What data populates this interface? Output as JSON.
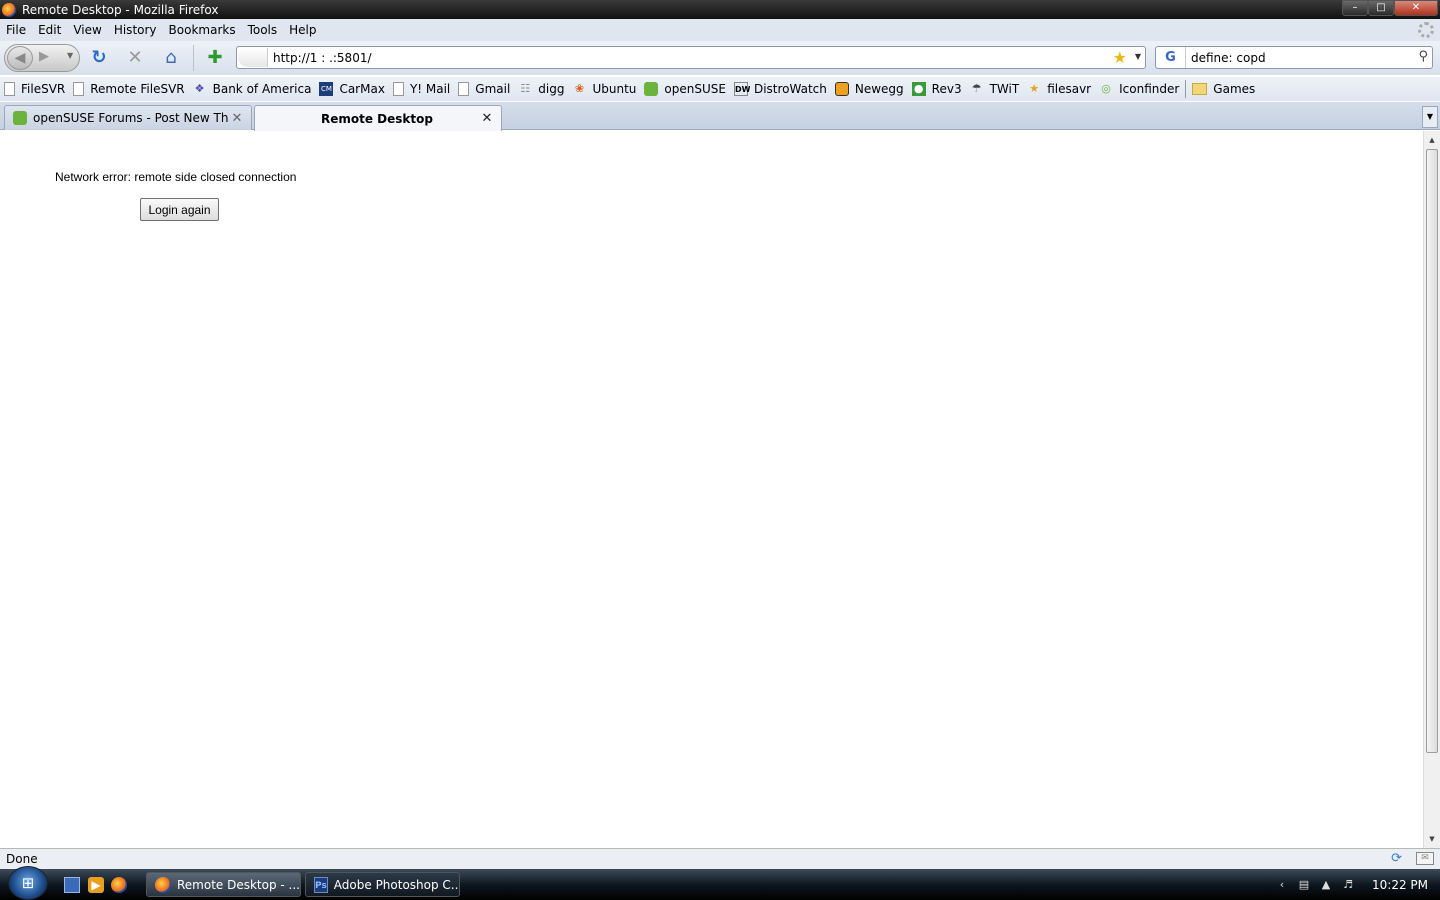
{
  "window": {
    "title": "Remote Desktop - Mozilla Firefox",
    "controls": {
      "minimize": "–",
      "maximize": "□",
      "close": "✕"
    }
  },
  "menu": [
    "File",
    "Edit",
    "View",
    "History",
    "Bookmarks",
    "Tools",
    "Help"
  ],
  "navigation": {
    "url": "http://1  :  .:5801/",
    "search_text": "define: copd",
    "search_engine": "G"
  },
  "bookmarks": [
    {
      "label": "FileSVR",
      "icon": "page-icon"
    },
    {
      "label": "Remote FileSVR",
      "icon": "page-icon"
    },
    {
      "label": "Bank of America",
      "icon": "bofa-icon"
    },
    {
      "label": "CarMax",
      "icon": "carmax-icon"
    },
    {
      "label": "Y! Mail",
      "icon": "page-icon"
    },
    {
      "label": "Gmail",
      "icon": "page-icon"
    },
    {
      "label": "digg",
      "icon": "digg-icon"
    },
    {
      "label": "Ubuntu",
      "icon": "ubuntu-icon"
    },
    {
      "label": "openSUSE",
      "icon": "opensuse-icon"
    },
    {
      "label": "DistroWatch",
      "icon": "distrowatch-icon"
    },
    {
      "label": "Newegg",
      "icon": "newegg-icon"
    },
    {
      "label": "Rev3",
      "icon": "rev3-icon"
    },
    {
      "label": "TWiT",
      "icon": "twit-icon"
    },
    {
      "label": "filesavr",
      "icon": "filesavr-icon"
    },
    {
      "label": "Iconfinder",
      "icon": "iconfinder-icon"
    },
    {
      "label": "Games",
      "icon": "folder-icon"
    }
  ],
  "tabs": [
    {
      "label": "openSUSE Forums - Post New Thread",
      "active": false
    },
    {
      "label": "Remote Desktop",
      "active": true
    }
  ],
  "content": {
    "error_message": "Network error: remote side closed connection",
    "login_button": "Login again"
  },
  "status": "Done",
  "taskbar": {
    "start_label": "⊞",
    "tasks": [
      {
        "label": "Remote Desktop - ...",
        "icon": "firefox-icon"
      },
      {
        "label": "Adobe Photoshop C...",
        "icon": "photoshop-icon"
      }
    ],
    "clock": "10:22 PM"
  },
  "colors": {
    "accent": "#2a6ac8",
    "opensuse_green": "#6cb33e"
  }
}
